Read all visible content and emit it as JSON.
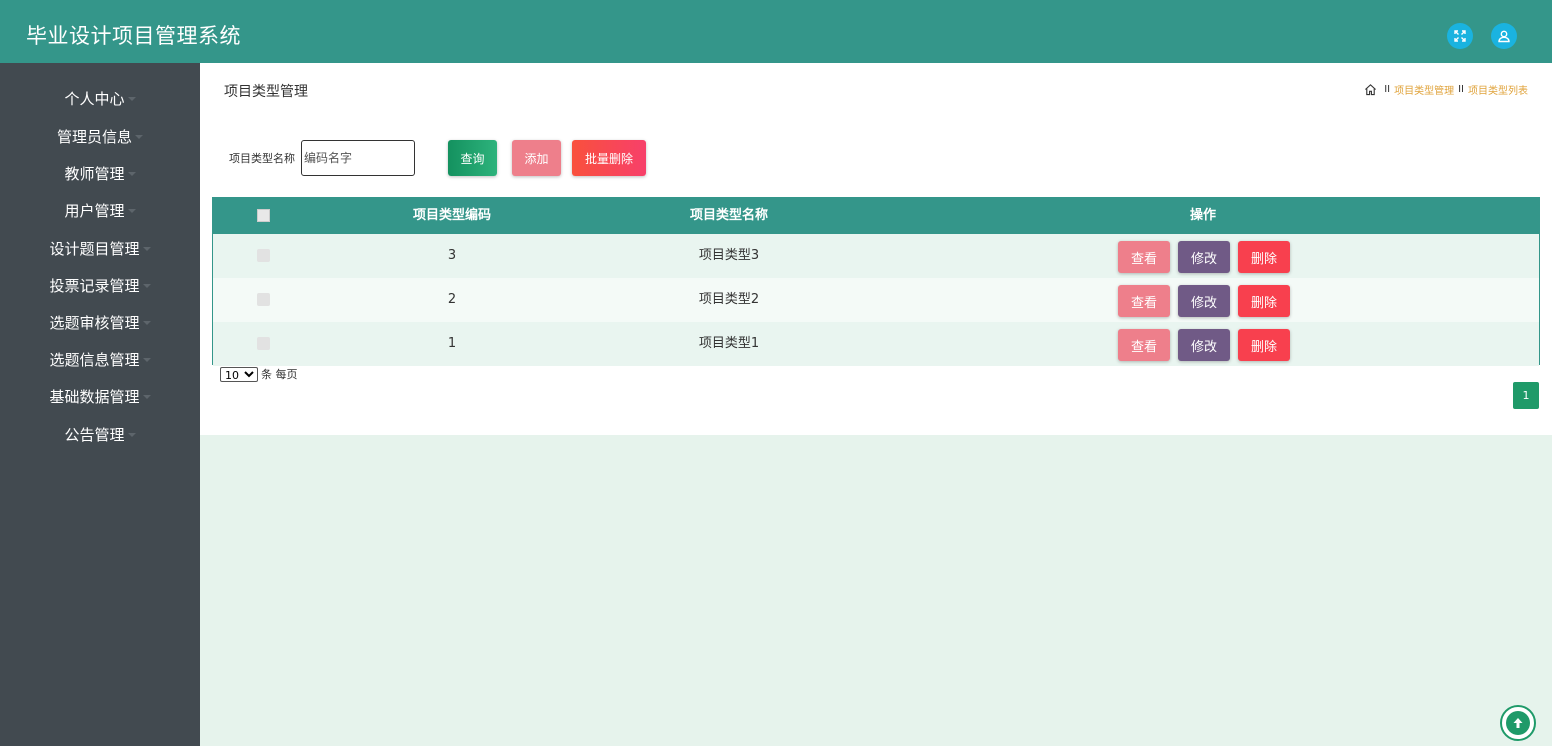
{
  "app": {
    "title": "毕业设计项目管理系统"
  },
  "header": {
    "icons": [
      {
        "name": "fullscreen-icon"
      },
      {
        "name": "user-icon"
      }
    ]
  },
  "sidebar": {
    "items": [
      {
        "label": "个人中心"
      },
      {
        "label": "管理员信息"
      },
      {
        "label": "教师管理"
      },
      {
        "label": "用户管理"
      },
      {
        "label": "设计题目管理"
      },
      {
        "label": "投票记录管理"
      },
      {
        "label": "选题审核管理"
      },
      {
        "label": "选题信息管理"
      },
      {
        "label": "基础数据管理"
      },
      {
        "label": "公告管理"
      }
    ]
  },
  "page": {
    "title": "项目类型管理",
    "breadcrumb": {
      "sep": "II",
      "items": [
        "项目类型管理",
        "项目类型列表"
      ]
    }
  },
  "search": {
    "label": "项目类型名称",
    "placeholder": "编码名字",
    "value": "",
    "query_label": "查询",
    "add_label": "添加",
    "batch_delete_label": "批量删除"
  },
  "table": {
    "headers": {
      "code": "项目类型编码",
      "name": "项目类型名称",
      "actions": "操作"
    },
    "rows": [
      {
        "code": "3",
        "name": "项目类型3"
      },
      {
        "code": "2",
        "name": "项目类型2"
      },
      {
        "code": "1",
        "name": "项目类型1"
      }
    ],
    "action_labels": {
      "view": "查看",
      "edit": "修改",
      "delete": "删除"
    }
  },
  "pagination": {
    "page_size": "10",
    "page_size_options": [
      "10"
    ],
    "per_page_label": "条 每页",
    "current_page": "1"
  },
  "colors": {
    "topbar": "#34968a",
    "sidebar": "#424a50",
    "accent_green": "#1f9a69",
    "pink": "#ee7f8b",
    "purple": "#705a86",
    "red": "#f8404e",
    "breadcrumb": "#e0a33b"
  }
}
